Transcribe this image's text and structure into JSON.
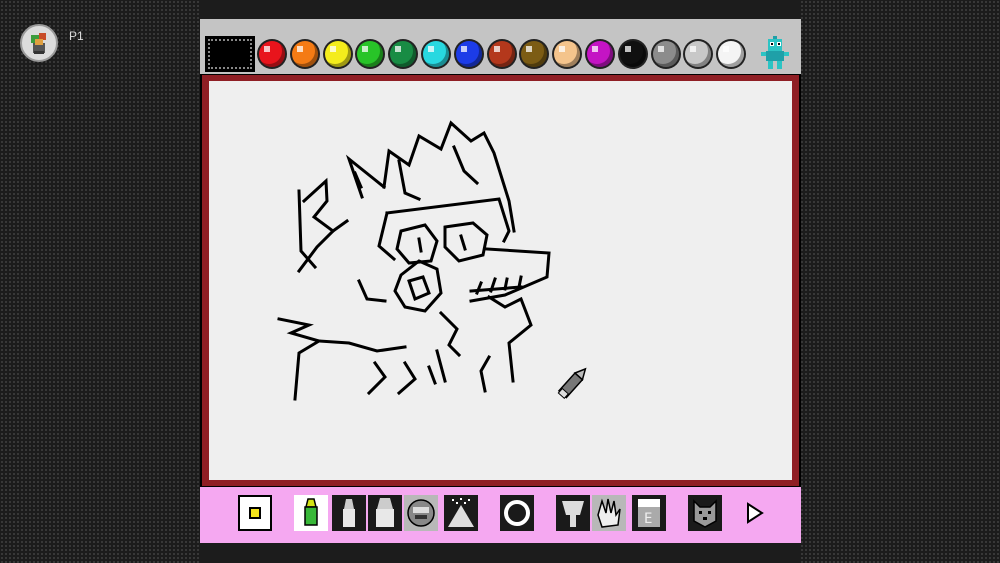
{
  "player": {
    "label": "P1",
    "avatar_icon": "player-avatar-icon"
  },
  "palette": {
    "current_color": "#000000",
    "swatches": [
      {
        "name": "red",
        "color": "#e8141c"
      },
      {
        "name": "orange",
        "color": "#f47b14"
      },
      {
        "name": "yellow",
        "color": "#f4ec1c"
      },
      {
        "name": "green",
        "color": "#28c428"
      },
      {
        "name": "dark-green",
        "color": "#188c44"
      },
      {
        "name": "cyan",
        "color": "#28d8e0"
      },
      {
        "name": "blue",
        "color": "#1c3ce8"
      },
      {
        "name": "brown-red",
        "color": "#b4381c"
      },
      {
        "name": "olive-brown",
        "color": "#7c5c14"
      },
      {
        "name": "peach",
        "color": "#f4c48c"
      },
      {
        "name": "magenta",
        "color": "#c414c4"
      },
      {
        "name": "black",
        "color": "#101010"
      },
      {
        "name": "gray",
        "color": "#8c8c8c"
      },
      {
        "name": "light-gray",
        "color": "#c8c8c8"
      },
      {
        "name": "white",
        "color": "#f4f4f4"
      }
    ],
    "mascot_icon": "cyan-robot-mascot-icon"
  },
  "canvas": {
    "background": "#efefef",
    "frame_color": "#8f1e24",
    "drawing": "line-art-character",
    "cursor_icon": "pencil-cursor-icon"
  },
  "toolbar": {
    "background": "#f5a8f1",
    "tools": [
      {
        "name": "brush-size-tool",
        "icon": "square-dot-icon"
      },
      {
        "name": "pencil-tool",
        "icon": "pencil-icon"
      },
      {
        "name": "marker-tool",
        "icon": "marker-icon"
      },
      {
        "name": "thick-marker-tool",
        "icon": "thick-marker-icon"
      },
      {
        "name": "stamp-tool",
        "icon": "face-stamp-icon"
      },
      {
        "name": "spray-tool",
        "icon": "spray-icon"
      },
      {
        "name": "circle-tool",
        "icon": "circle-icon"
      },
      {
        "name": "paint-bucket-tool",
        "icon": "bucket-icon"
      },
      {
        "name": "hand-tool",
        "icon": "hand-icon"
      },
      {
        "name": "eraser-tool",
        "icon": "eraser-icon"
      },
      {
        "name": "dog-stamp-tool",
        "icon": "dog-face-icon"
      },
      {
        "name": "next-page-tool",
        "icon": "arrow-right-icon"
      }
    ]
  }
}
